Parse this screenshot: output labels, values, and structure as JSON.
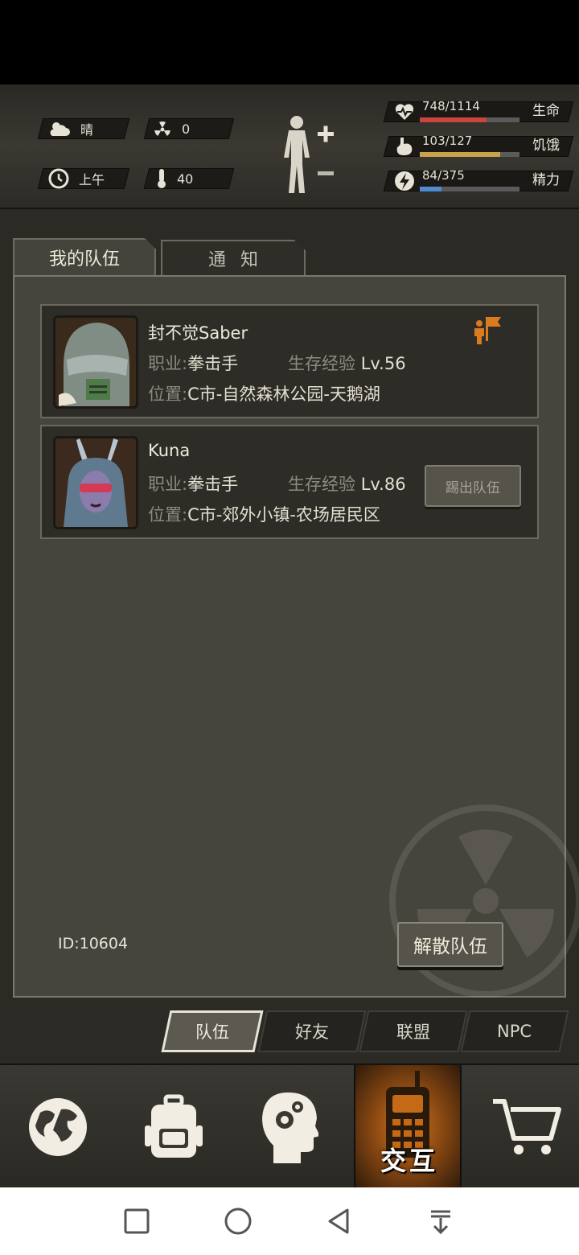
{
  "hud": {
    "weather": "晴",
    "radiation": "0",
    "time_of_day": "上午",
    "temperature": "40",
    "stats": [
      {
        "value": "748/1114",
        "label": "生命",
        "fraction": 0.67,
        "color": "#c9453e",
        "icon": "heart-pulse-icon"
      },
      {
        "value": "103/127",
        "label": "饥饿",
        "fraction": 0.81,
        "color": "#caa24a",
        "icon": "stomach-icon"
      },
      {
        "value": "84/375",
        "label": "精力",
        "fraction": 0.22,
        "color": "#4f8ad3",
        "icon": "energy-bolt-icon"
      }
    ]
  },
  "tabs": {
    "my_team": "我的队伍",
    "notice": "通知"
  },
  "members": [
    {
      "name": "封不觉Saber",
      "job_label": "职业:",
      "job": "拳击手",
      "exp_label": "生存经验",
      "level": "Lv.56",
      "loc_label": "位置:",
      "location": "C市-自然森林公园-天鹅湖",
      "is_leader": true
    },
    {
      "name": "Kuna",
      "job_label": "职业:",
      "job": "拳击手",
      "exp_label": "生存经验",
      "level": "Lv.86",
      "loc_label": "位置:",
      "location": "C市-郊外小镇-农场居民区",
      "kick_label": "踢出队伍"
    }
  ],
  "player_id": "ID:10604",
  "disband_label": "解散队伍",
  "subtabs": [
    "队伍",
    "好友",
    "联盟",
    "NPC"
  ],
  "bottom_nav": {
    "active_label": "交互"
  }
}
